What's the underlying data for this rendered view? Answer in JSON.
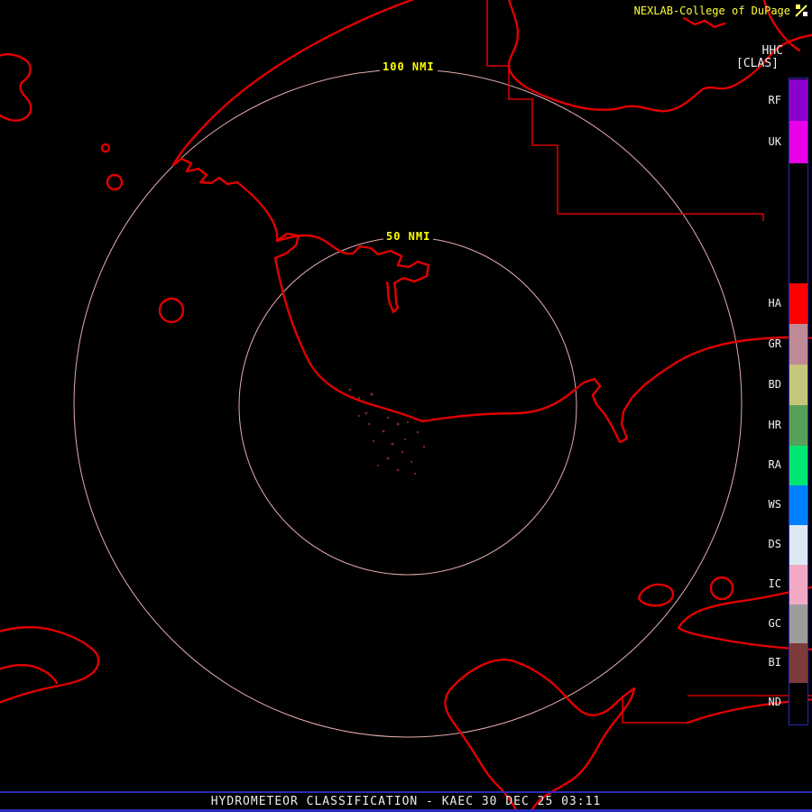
{
  "header": {
    "brand": "NEXLAB-College of DuPage",
    "product_code": "HHC",
    "product_mode": "[CLAS]"
  },
  "range_rings": {
    "outer_label": "100 NMI",
    "inner_label": "50 NMI"
  },
  "legend": {
    "categories": [
      {
        "code": "RF",
        "color": "#8a00cc"
      },
      {
        "code": "UK",
        "color": "#e800e8"
      },
      {
        "code": "HA",
        "color": "#ff0000"
      },
      {
        "code": "GR",
        "color": "#bf8a96"
      },
      {
        "code": "BD",
        "color": "#c6c67a"
      },
      {
        "code": "HR",
        "color": "#57a05a"
      },
      {
        "code": "RA",
        "color": "#00e673"
      },
      {
        "code": "WS",
        "color": "#0080ff"
      },
      {
        "code": "DS",
        "color": "#dce9f5"
      },
      {
        "code": "IC",
        "color": "#f2aac4"
      },
      {
        "code": "GC",
        "color": "#9c9c9c"
      },
      {
        "code": "BI",
        "color": "#7c3a3a"
      },
      {
        "code": "ND",
        "color": "#000000"
      }
    ]
  },
  "footer": {
    "title": "HYDROMETEOR CLASSIFICATION - KAEC 30 DEC 25 03:11"
  },
  "colors": {
    "map_outline": "#e10000",
    "range_ring": "#ffc0c0",
    "accent_yellow": "#ffff00",
    "frame_blue": "#2a2ab8"
  }
}
